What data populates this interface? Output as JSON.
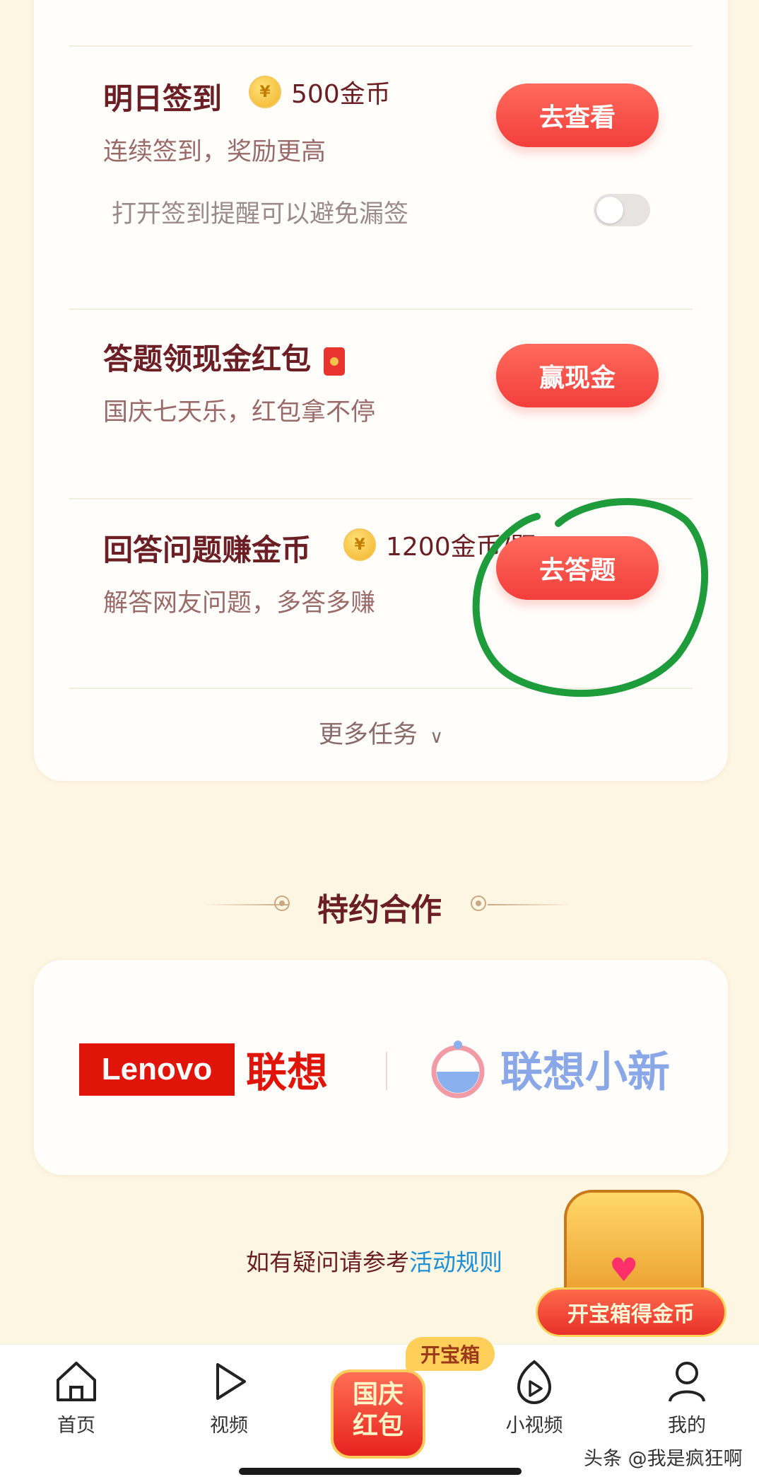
{
  "tasks": [
    {
      "title": "明日签到",
      "reward": "500金币",
      "subtitle": "连续签到，奖励更高",
      "button": "去查看",
      "reminder": "打开签到提醒可以避免漏签",
      "reminder_toggle": "off"
    },
    {
      "title": "答题领现金红包",
      "subtitle": "国庆七天乐，红包拿不停",
      "button": "赢现金"
    },
    {
      "title": "回答问题赚金币",
      "reward": "1200金币/题",
      "subtitle": "解答网友问题，多答多赚",
      "button": "去答题"
    }
  ],
  "more_tasks": "更多任务",
  "section_title": "特约合作",
  "partners": {
    "lenovo_en": "Lenovo",
    "lenovo_cn": "联想",
    "xiaoxin": "联想小新"
  },
  "help": {
    "text": "如有疑问请参考",
    "link": "活动规则"
  },
  "chest": {
    "button": "开宝箱得金币"
  },
  "tabbar": {
    "home": "首页",
    "video": "视频",
    "center_badge": "开宝箱",
    "center_line1": "国庆",
    "center_line2": "红包",
    "small_video": "小视频",
    "mine": "我的"
  },
  "watermark": "头条 @我是疯狂啊",
  "colors": {
    "accent": "#f23f3c",
    "title": "#6b1f24",
    "background": "#fdf6e3",
    "link": "#1f8fd6",
    "annotation": "#1e9b3a"
  }
}
